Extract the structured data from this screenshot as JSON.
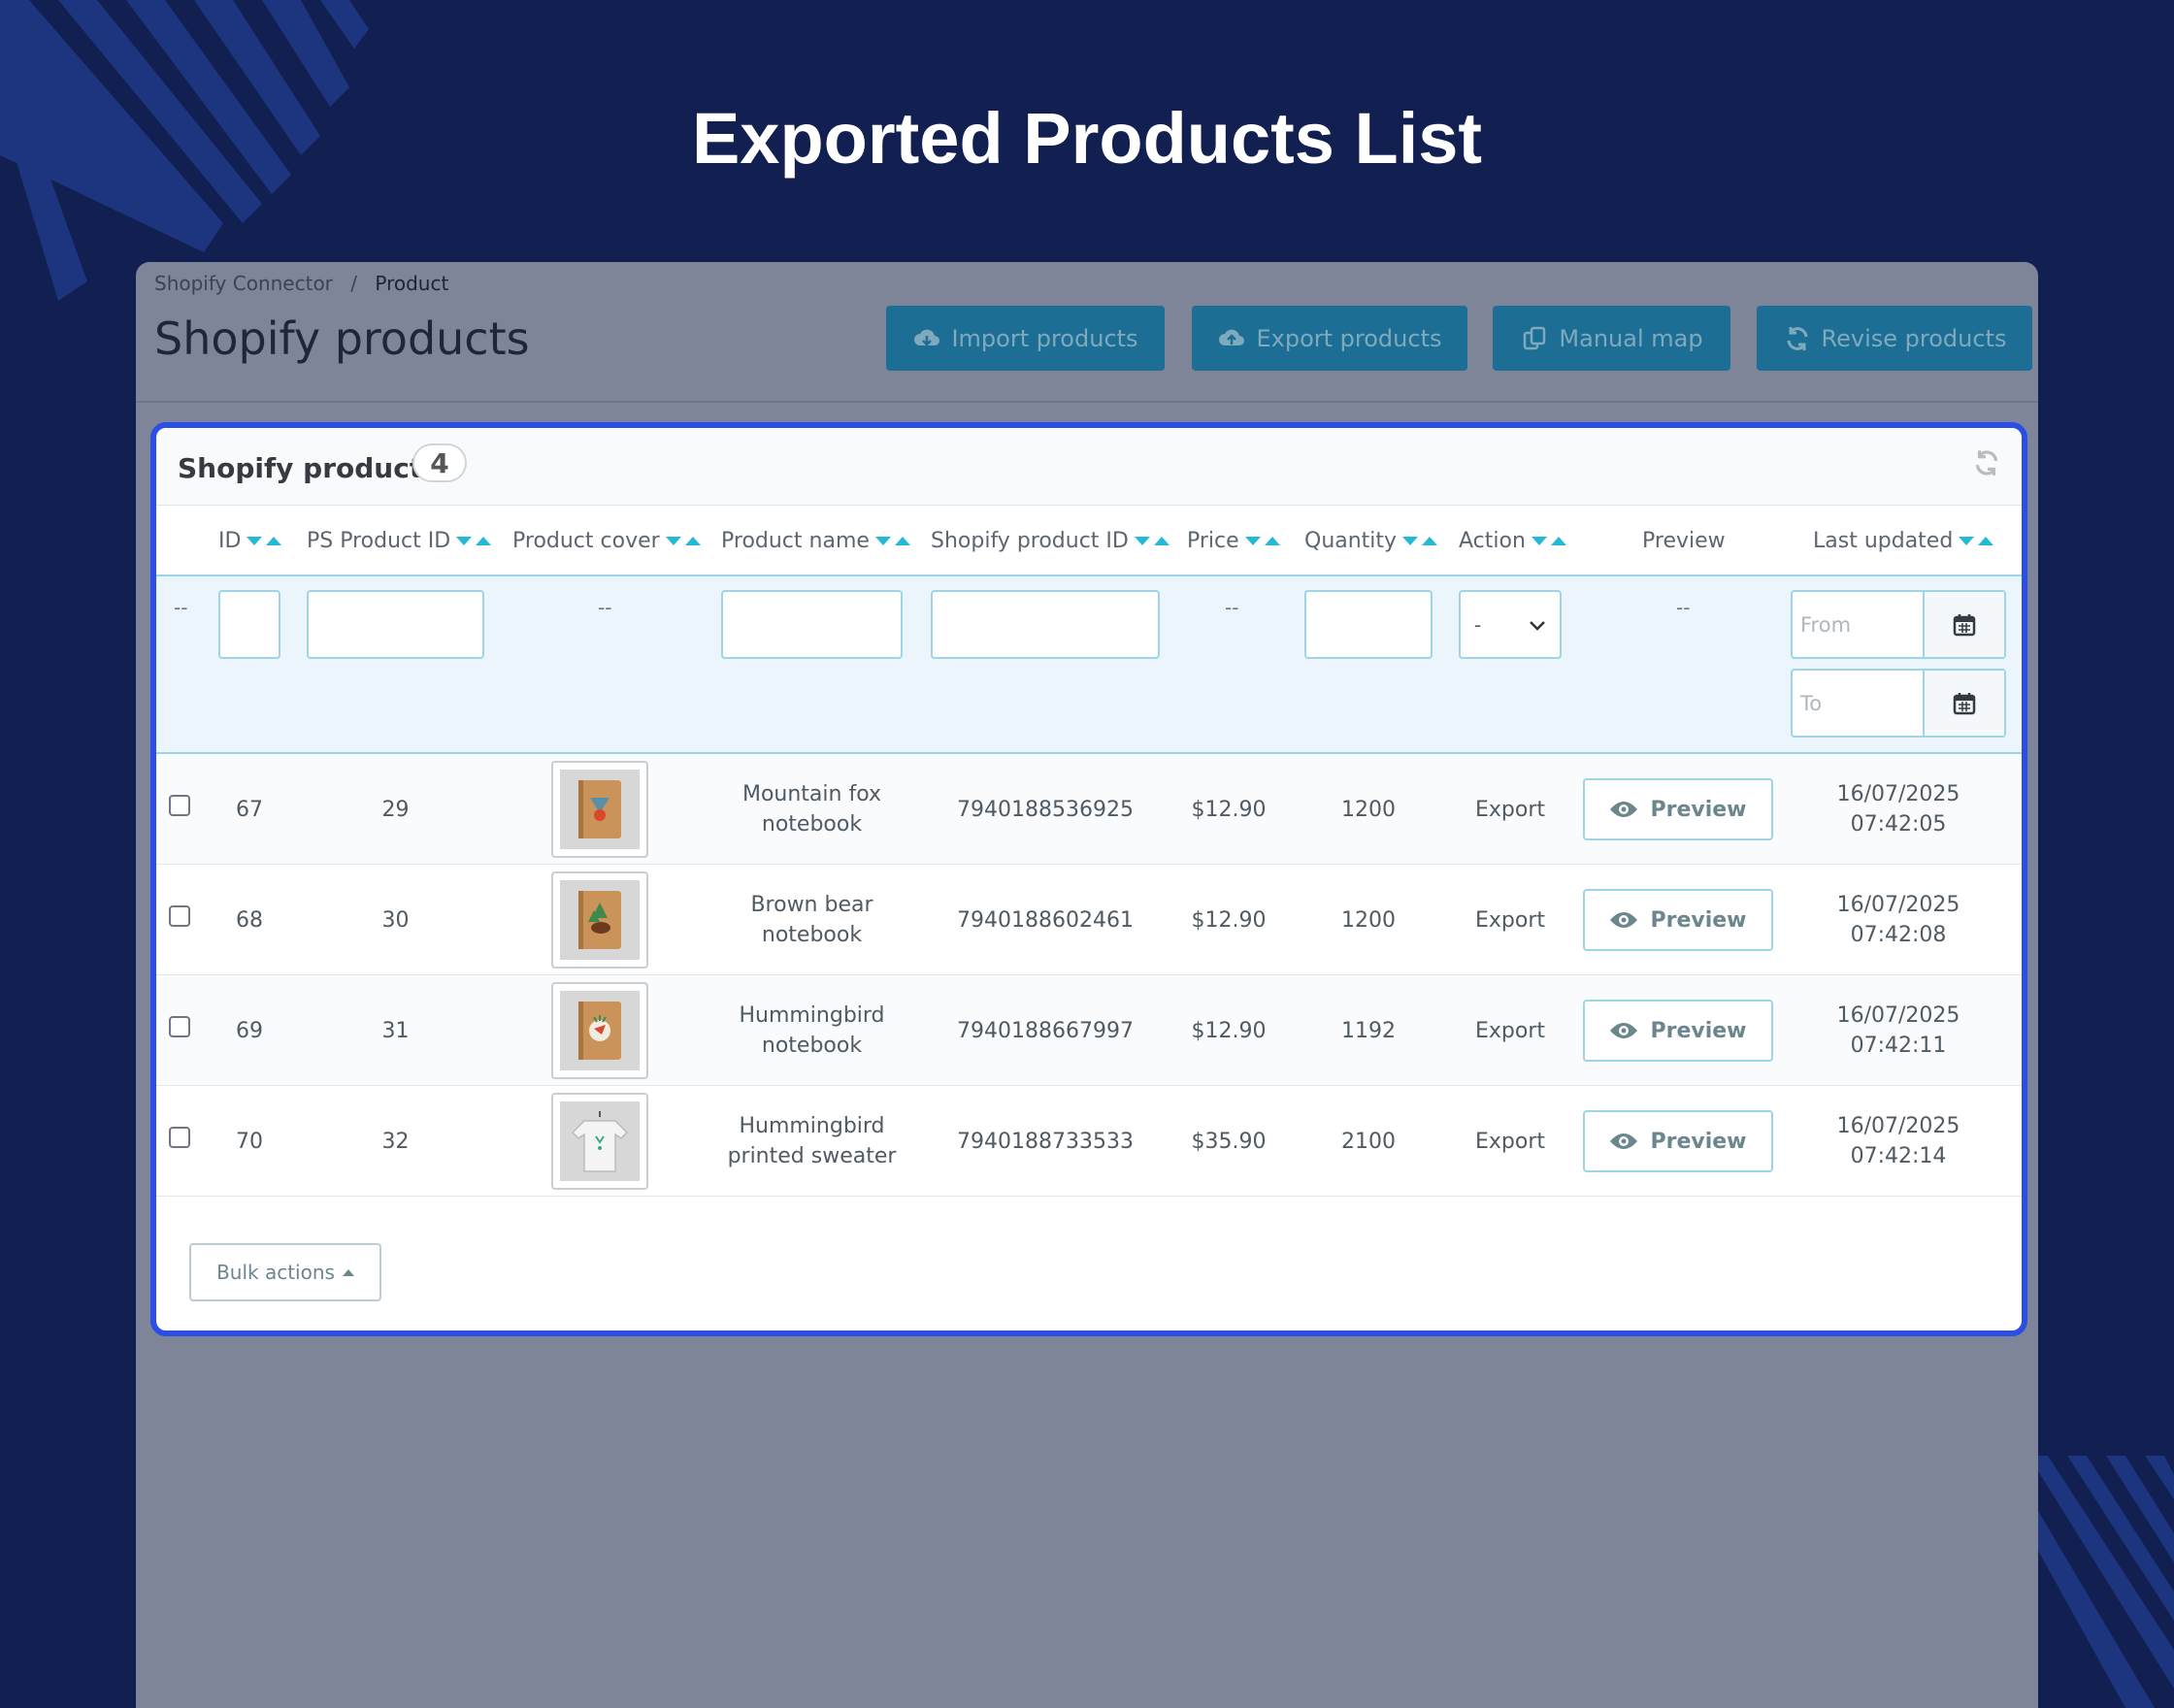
{
  "headline": "Exported Products List",
  "breadcrumb": {
    "parent": "Shopify Connector",
    "separator": "/",
    "current": "Product"
  },
  "page_title": "Shopify products",
  "toolbar": {
    "import_label": "Import products",
    "export_label": "Export products",
    "manual_map_label": "Manual map",
    "revise_label": "Revise products"
  },
  "panel": {
    "title": "Shopify products",
    "count": "4",
    "columns": {
      "id": "ID",
      "ps_product_id": "PS Product ID",
      "product_cover": "Product cover",
      "product_name": "Product name",
      "shopify_product_id": "Shopify product ID",
      "price": "Price",
      "quantity": "Quantity",
      "action": "Action",
      "preview": "Preview",
      "last_updated": "Last updated"
    },
    "filters": {
      "empty": "--",
      "action_select_value": "-",
      "date_from_placeholder": "From",
      "date_to_placeholder": "To"
    },
    "rows": [
      {
        "id": "67",
        "ps_id": "29",
        "name_l1": "Mountain fox",
        "name_l2": "notebook",
        "shopify_id": "7940188536925",
        "price": "$12.90",
        "quantity": "1200",
        "action": "Export",
        "preview": "Preview",
        "date": "16/07/2025",
        "time": "07:42:05",
        "cover_icon": "fox-notebook"
      },
      {
        "id": "68",
        "ps_id": "30",
        "name_l1": "Brown bear",
        "name_l2": "notebook",
        "shopify_id": "7940188602461",
        "price": "$12.90",
        "quantity": "1200",
        "action": "Export",
        "preview": "Preview",
        "date": "16/07/2025",
        "time": "07:42:08",
        "cover_icon": "bear-notebook"
      },
      {
        "id": "69",
        "ps_id": "31",
        "name_l1": "Hummingbird",
        "name_l2": "notebook",
        "shopify_id": "7940188667997",
        "price": "$12.90",
        "quantity": "1192",
        "action": "Export",
        "preview": "Preview",
        "date": "16/07/2025",
        "time": "07:42:11",
        "cover_icon": "hummingbird-notebook"
      },
      {
        "id": "70",
        "ps_id": "32",
        "name_l1": "Hummingbird",
        "name_l2": "printed sweater",
        "shopify_id": "7940188733533",
        "price": "$35.90",
        "quantity": "2100",
        "action": "Export",
        "preview": "Preview",
        "date": "16/07/2025",
        "time": "07:42:14",
        "cover_icon": "sweater"
      }
    ],
    "bulk_actions_label": "Bulk actions"
  },
  "colors": {
    "background": "#111f51",
    "accent": "#25b9d7",
    "panel_border": "#2b4ee6",
    "toolbar_button": "#1d6e94"
  }
}
